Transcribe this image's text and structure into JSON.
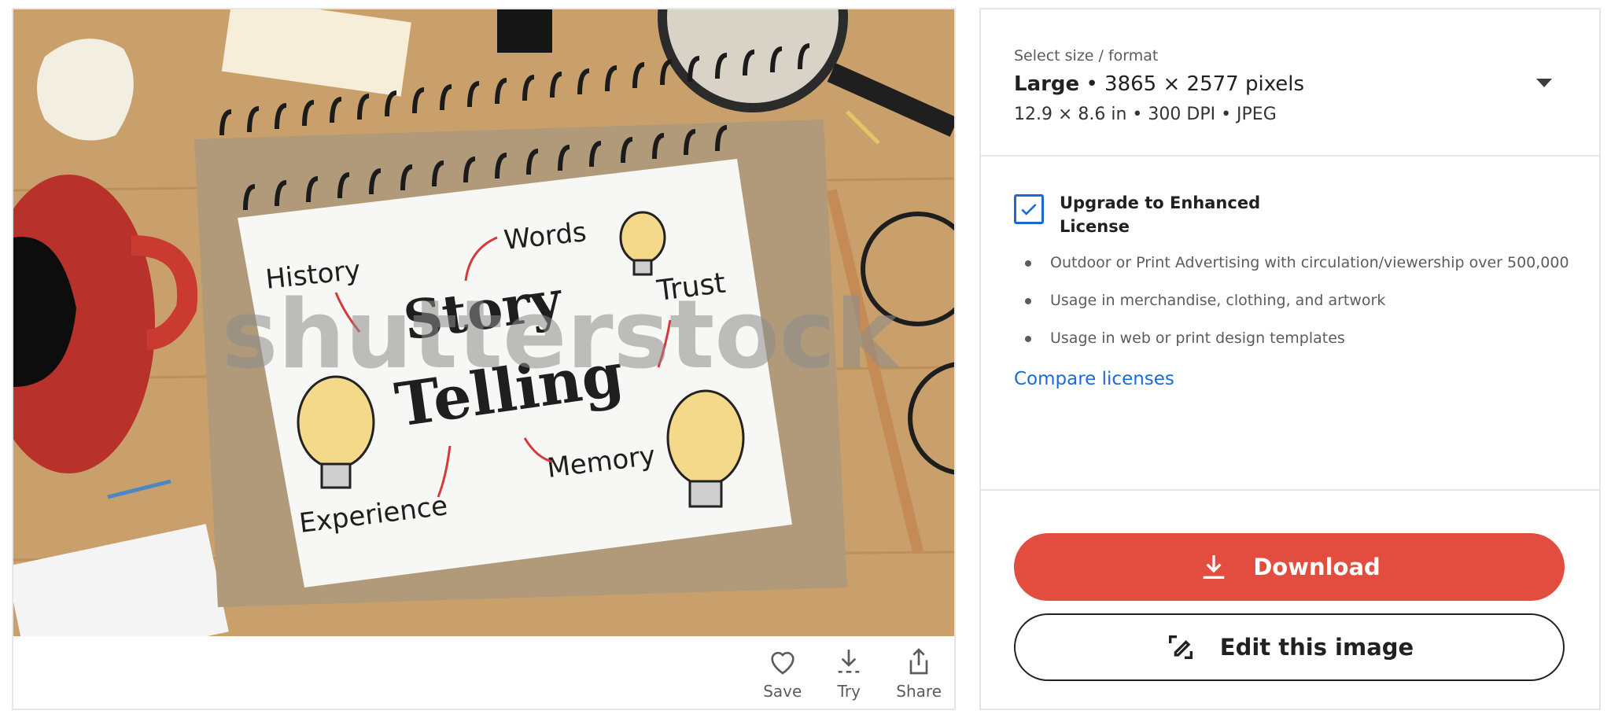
{
  "image": {
    "watermark": "shutterstock",
    "notebook_words": {
      "history": "History",
      "words": "Words",
      "trust": "Trust",
      "story": "Story",
      "telling": "Telling",
      "experience": "Experience",
      "memory": "Memory"
    }
  },
  "image_actions": [
    {
      "label": "Save",
      "icon": "heart-icon"
    },
    {
      "label": "Try",
      "icon": "download-dashed-icon"
    },
    {
      "label": "Share",
      "icon": "share-icon"
    }
  ],
  "size": {
    "caption": "Select size / format",
    "name": "Large",
    "dimensions": " • 3865 × 2577 pixels",
    "detail": "12.9 × 8.6 in • 300 DPI • JPEG"
  },
  "license": {
    "checked": true,
    "label": "Upgrade to Enhanced License",
    "bullets": [
      "Outdoor or Print Advertising with circulation/viewership over 500,000",
      "Usage in merchandise, clothing, and artwork",
      "Usage in web or print design templates"
    ],
    "compare_link": "Compare licenses"
  },
  "buttons": {
    "download": "Download",
    "edit": "Edit this image"
  },
  "colors": {
    "accent_red": "#e34d3f",
    "link_blue": "#1d6ad7"
  }
}
